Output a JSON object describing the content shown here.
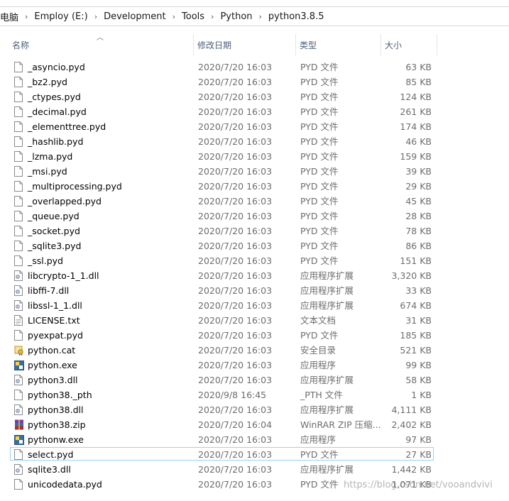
{
  "breadcrumb": [
    "电脑",
    "Employ (E:)",
    "Development",
    "Tools",
    "Python",
    "python3.8.5"
  ],
  "columns": {
    "name": "名称",
    "date": "修改日期",
    "type": "类型",
    "size": "大小"
  },
  "files": [
    {
      "name": "_asyncio.pyd",
      "date": "2020/7/20 16:03",
      "type": "PYD 文件",
      "size": "63 KB",
      "icon": "file-icon"
    },
    {
      "name": "_bz2.pyd",
      "date": "2020/7/20 16:03",
      "type": "PYD 文件",
      "size": "85 KB",
      "icon": "file-icon"
    },
    {
      "name": "_ctypes.pyd",
      "date": "2020/7/20 16:03",
      "type": "PYD 文件",
      "size": "124 KB",
      "icon": "file-icon"
    },
    {
      "name": "_decimal.pyd",
      "date": "2020/7/20 16:03",
      "type": "PYD 文件",
      "size": "261 KB",
      "icon": "file-icon"
    },
    {
      "name": "_elementtree.pyd",
      "date": "2020/7/20 16:03",
      "type": "PYD 文件",
      "size": "174 KB",
      "icon": "file-icon"
    },
    {
      "name": "_hashlib.pyd",
      "date": "2020/7/20 16:03",
      "type": "PYD 文件",
      "size": "46 KB",
      "icon": "file-icon"
    },
    {
      "name": "_lzma.pyd",
      "date": "2020/7/20 16:03",
      "type": "PYD 文件",
      "size": "159 KB",
      "icon": "file-icon"
    },
    {
      "name": "_msi.pyd",
      "date": "2020/7/20 16:03",
      "type": "PYD 文件",
      "size": "39 KB",
      "icon": "file-icon"
    },
    {
      "name": "_multiprocessing.pyd",
      "date": "2020/7/20 16:03",
      "type": "PYD 文件",
      "size": "29 KB",
      "icon": "file-icon"
    },
    {
      "name": "_overlapped.pyd",
      "date": "2020/7/20 16:03",
      "type": "PYD 文件",
      "size": "45 KB",
      "icon": "file-icon"
    },
    {
      "name": "_queue.pyd",
      "date": "2020/7/20 16:03",
      "type": "PYD 文件",
      "size": "28 KB",
      "icon": "file-icon"
    },
    {
      "name": "_socket.pyd",
      "date": "2020/7/20 16:03",
      "type": "PYD 文件",
      "size": "78 KB",
      "icon": "file-icon"
    },
    {
      "name": "_sqlite3.pyd",
      "date": "2020/7/20 16:03",
      "type": "PYD 文件",
      "size": "86 KB",
      "icon": "file-icon"
    },
    {
      "name": "_ssl.pyd",
      "date": "2020/7/20 16:03",
      "type": "PYD 文件",
      "size": "151 KB",
      "icon": "file-icon"
    },
    {
      "name": "libcrypto-1_1.dll",
      "date": "2020/7/20 16:03",
      "type": "应用程序扩展",
      "size": "3,320 KB",
      "icon": "dll-icon"
    },
    {
      "name": "libffi-7.dll",
      "date": "2020/7/20 16:03",
      "type": "应用程序扩展",
      "size": "33 KB",
      "icon": "dll-icon"
    },
    {
      "name": "libssl-1_1.dll",
      "date": "2020/7/20 16:03",
      "type": "应用程序扩展",
      "size": "674 KB",
      "icon": "dll-icon"
    },
    {
      "name": "LICENSE.txt",
      "date": "2020/7/20 16:03",
      "type": "文本文档",
      "size": "31 KB",
      "icon": "text-file-icon"
    },
    {
      "name": "pyexpat.pyd",
      "date": "2020/7/20 16:03",
      "type": "PYD 文件",
      "size": "185 KB",
      "icon": "file-icon"
    },
    {
      "name": "python.cat",
      "date": "2020/7/20 16:03",
      "type": "安全目录",
      "size": "521 KB",
      "icon": "security-catalog-icon"
    },
    {
      "name": "python.exe",
      "date": "2020/7/20 16:03",
      "type": "应用程序",
      "size": "99 KB",
      "icon": "python-exe-icon"
    },
    {
      "name": "python3.dll",
      "date": "2020/7/20 16:03",
      "type": "应用程序扩展",
      "size": "58 KB",
      "icon": "dll-icon"
    },
    {
      "name": "python38._pth",
      "date": "2020/9/8 16:45",
      "type": "_PTH 文件",
      "size": "1 KB",
      "icon": "file-icon"
    },
    {
      "name": "python38.dll",
      "date": "2020/7/20 16:03",
      "type": "应用程序扩展",
      "size": "4,111 KB",
      "icon": "dll-icon"
    },
    {
      "name": "python38.zip",
      "date": "2020/7/20 16:04",
      "type": "WinRAR ZIP 压缩...",
      "size": "2,402 KB",
      "icon": "winrar-archive-icon"
    },
    {
      "name": "pythonw.exe",
      "date": "2020/7/20 16:03",
      "type": "应用程序",
      "size": "97 KB",
      "icon": "python-exe-icon"
    },
    {
      "name": "select.pyd",
      "date": "2020/7/20 16:03",
      "type": "PYD 文件",
      "size": "27 KB",
      "icon": "file-icon",
      "selected": true
    },
    {
      "name": "sqlite3.dll",
      "date": "2020/7/20 16:03",
      "type": "应用程序扩展",
      "size": "1,442 KB",
      "icon": "dll-icon"
    },
    {
      "name": "unicodedata.pyd",
      "date": "2020/7/20 16:03",
      "type": "PYD 文件",
      "size": "1,071 KB",
      "icon": "file-icon"
    }
  ],
  "watermark": "https://blog.csdn.net/vooandvivi"
}
